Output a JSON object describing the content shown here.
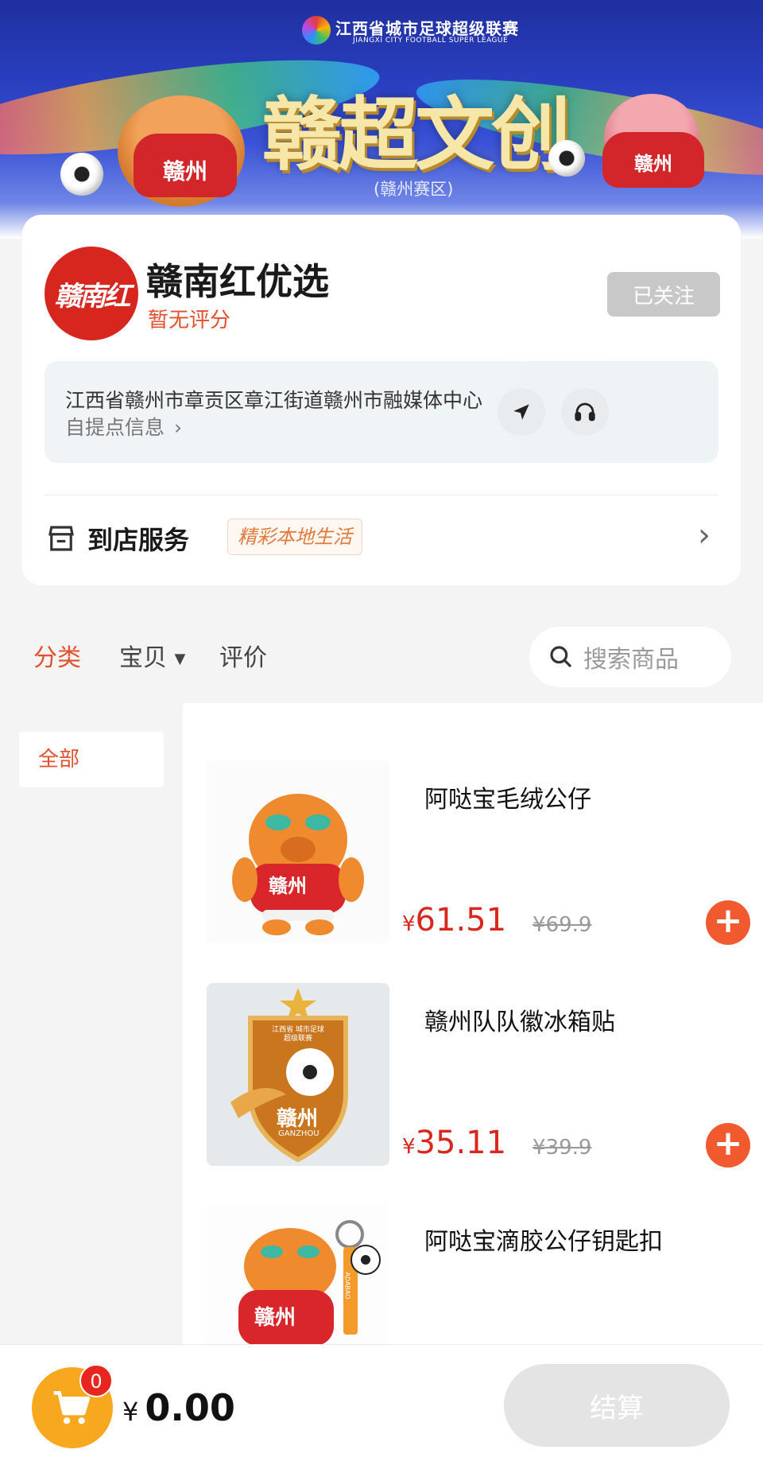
{
  "banner": {
    "league_title": "江西省城市足球超级联赛",
    "league_subtitle": "JIANGXI CITY FOOTBALL SUPER LEAGUE",
    "title": "赣超文创",
    "subtitle": "(赣州赛区)",
    "mascot_shirt_text": "赣州"
  },
  "store": {
    "logo_text": "赣南红",
    "name": "赣南红优选",
    "rating": "暂无评分",
    "follow_label": "已关注",
    "address": "江西省赣州市章贡区章江街道赣州市融媒体中心",
    "pickup_label": "自提点信息",
    "service_label": "到店服务",
    "service_tag": "精彩本地生活"
  },
  "tabs": {
    "category": "分类",
    "items": "宝贝",
    "reviews": "评价",
    "search_placeholder": "搜索商品"
  },
  "categories": [
    {
      "label": "全部"
    }
  ],
  "products": [
    {
      "name": "阿哒宝毛绒公仔",
      "price": "61.51",
      "original_price": "¥69.9",
      "image_text": "赣州"
    },
    {
      "name": "赣州队队徽冰箱贴",
      "price": "35.11",
      "original_price": "¥39.9",
      "image_text": "赣州",
      "image_sub": "GANZHOU",
      "image_top": "江西省 城市足球超级联赛"
    },
    {
      "name": "阿哒宝滴胶公仔钥匙扣",
      "image_text": "赣州",
      "image_tag": "ADABAO"
    }
  ],
  "cart": {
    "count": "0",
    "currency": "¥",
    "total": "0.00",
    "checkout_label": "结算"
  },
  "colors": {
    "accent": "#e2502d",
    "price": "#d8271f",
    "add_button": "#f05a2e",
    "cart": "#f7a81e"
  }
}
